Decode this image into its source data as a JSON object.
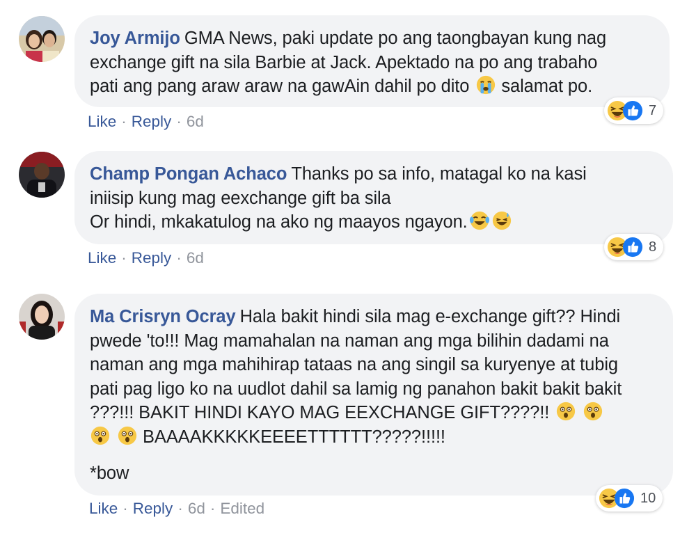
{
  "comments": [
    {
      "author": "Joy Armijo",
      "lines": [
        "GMA News, paki update po ang taongbayan kung nag",
        "exchange gift na sila Barbie at Jack. Apektado na po ang trabaho",
        "pati ang pang araw araw na gawAin dahil po dito",
        "salamat po."
      ],
      "emoji": "crying-face",
      "actions": {
        "like": "Like",
        "reply": "Reply",
        "time": "6d"
      },
      "reaction_count": "7"
    },
    {
      "author": "Champ Pongan Achaco",
      "lines": [
        "Thanks po sa info, matagal ko na kasi",
        "iniisip kung mag eexchange gift ba sila",
        "Or hindi, mkakatulog na ako ng maayos ngayon."
      ],
      "emoji": [
        "tears-of-joy",
        "grinning-sweat"
      ],
      "actions": {
        "like": "Like",
        "reply": "Reply",
        "time": "6d"
      },
      "reaction_count": "8"
    },
    {
      "author": "Ma Crisryn Ocray",
      "lines": [
        "Hala bakit hindi sila mag e-exchange gift?? Hindi",
        "pwede 'to!!! Mag mamahalan na naman ang mga bilihin dadami na",
        "naman ang mga mahihirap tataas na ang singil sa kuryenye at tubig",
        "pati pag ligo ko na uudlot dahil sa lamig ng panahon bakit bakit bakit",
        "???!!! BAKIT HINDI KAYO MAG EEXCHANGE GIFT????!!",
        "BAAAAKKKKKEEEETTTTTT?????!!!!!",
        "*bow"
      ],
      "emoji": "astonished-face",
      "actions": {
        "like": "Like",
        "reply": "Reply",
        "time": "6d",
        "edited": "Edited"
      },
      "reaction_count": "10"
    }
  ],
  "reaction_icons": [
    "haha-icon",
    "like-icon"
  ],
  "colors": {
    "author": "#385898",
    "bubble": "#f2f3f5",
    "like_blue": "#1877f2",
    "meta": "#90949c"
  }
}
